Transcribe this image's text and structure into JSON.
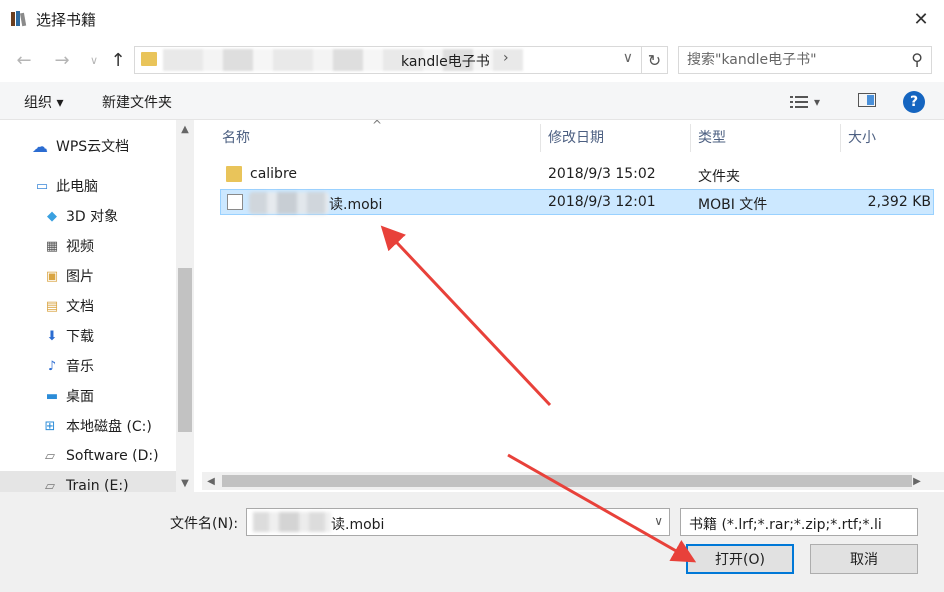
{
  "window": {
    "title": "选择书籍",
    "close_symbol": "✕"
  },
  "navigation": {
    "back_icon": "arrow-left-icon",
    "forward_icon": "arrow-right-icon",
    "recent_icon": "chevron-down-icon",
    "up_icon": "arrow-up-icon",
    "breadcrumb_current": "kandle电子书",
    "refresh_icon": "refresh-icon",
    "search_placeholder": "搜索\"kandle电子书\""
  },
  "toolbar": {
    "organize_label": "组织 ▾",
    "new_folder_label": "新建文件夹",
    "view_icon": "view-list-icon",
    "preview_icon": "preview-pane-icon",
    "help_label": "?"
  },
  "sidebar": {
    "items": [
      {
        "label": "WPS云文档",
        "icon": "cloud-icon"
      },
      {
        "label": "此电脑",
        "icon": "computer-icon"
      },
      {
        "label": "3D 对象",
        "icon": "3d-objects-icon"
      },
      {
        "label": "视频",
        "icon": "video-icon"
      },
      {
        "label": "图片",
        "icon": "pictures-icon"
      },
      {
        "label": "文档",
        "icon": "documents-icon"
      },
      {
        "label": "下载",
        "icon": "download-icon"
      },
      {
        "label": "音乐",
        "icon": "music-icon"
      },
      {
        "label": "桌面",
        "icon": "desktop-icon"
      },
      {
        "label": "本地磁盘 (C:)",
        "icon": "drive-icon"
      },
      {
        "label": "Software (D:)",
        "icon": "drive-icon"
      },
      {
        "label": "Train (E:)",
        "icon": "drive-icon"
      }
    ]
  },
  "file_list": {
    "columns": [
      "名称",
      "修改日期",
      "类型",
      "大小"
    ],
    "rows": [
      {
        "name": "calibre",
        "date": "2018/9/3 15:02",
        "type": "文件夹",
        "size": "",
        "icon": "folder-icon",
        "selected": false
      },
      {
        "name": "读.mobi",
        "date": "2018/9/3 12:01",
        "type": "MOBI 文件",
        "size": "2,392 KB",
        "icon": "file-icon",
        "selected": true
      }
    ]
  },
  "footer": {
    "filename_label": "文件名(N):",
    "filename_value": "读.mobi",
    "filetype_value": "书籍 (*.lrf;*.rar;*.zip;*.rtf;*.li",
    "open_label": "打开(O)",
    "cancel_label": "取消"
  },
  "annotation_color": "#e8413a"
}
